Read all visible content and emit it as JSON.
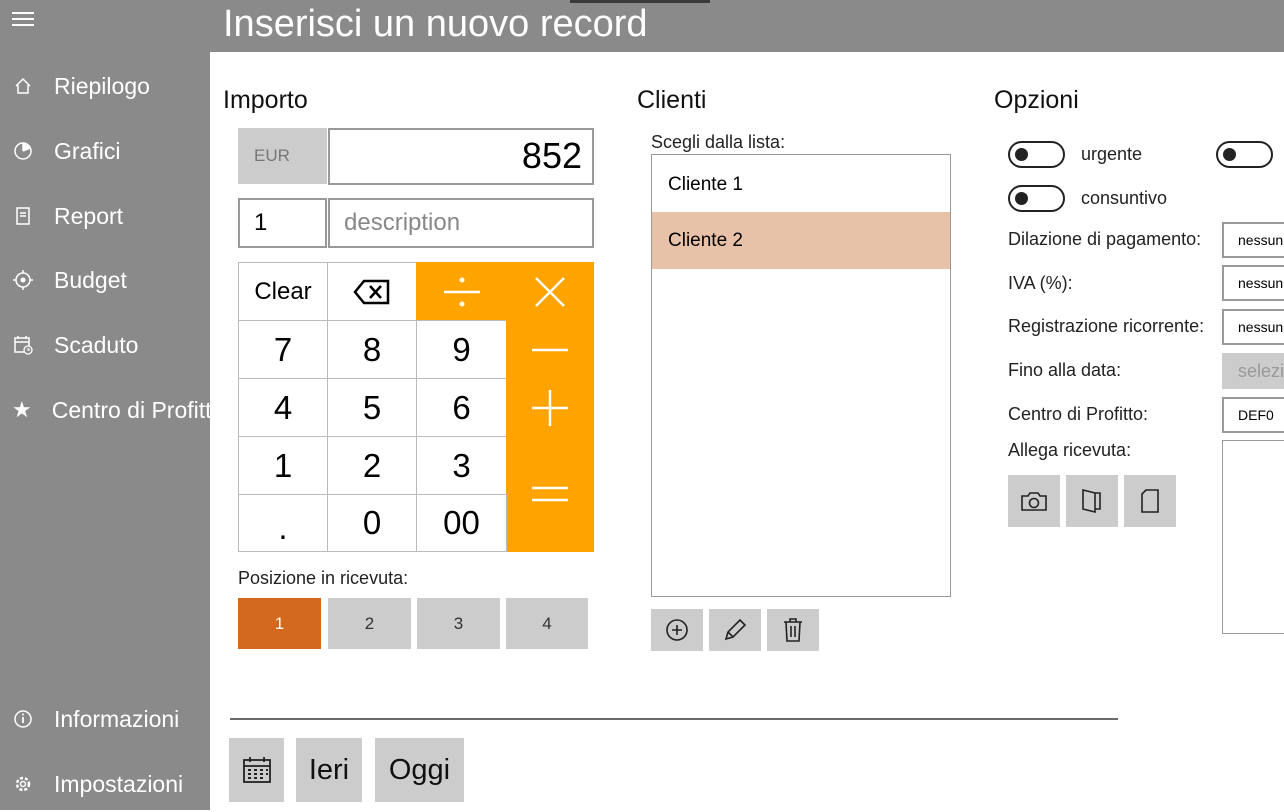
{
  "window": {
    "title": "Inserisci un nuovo record"
  },
  "sidebar": {
    "items": [
      {
        "label": "Riepilogo",
        "icon": "home-icon"
      },
      {
        "label": "Grafici",
        "icon": "pie-chart-icon"
      },
      {
        "label": "Report",
        "icon": "report-icon"
      },
      {
        "label": "Budget",
        "icon": "budget-icon"
      },
      {
        "label": "Scaduto",
        "icon": "calendar-due-icon"
      },
      {
        "label": "Centro di Profitto",
        "icon": "star-icon"
      }
    ],
    "bottom_items": [
      {
        "label": "Informazioni",
        "icon": "info-icon"
      },
      {
        "label": "Impostazioni",
        "icon": "gear-icon"
      }
    ]
  },
  "importo": {
    "title": "Importo",
    "currency": "EUR",
    "amount": "852",
    "quantity": "1",
    "description_placeholder": "description",
    "keys": {
      "clear": "Clear",
      "k7": "7",
      "k8": "8",
      "k9": "9",
      "k4": "4",
      "k5": "5",
      "k6": "6",
      "k1": "1",
      "k2": "2",
      "k3": "3",
      "dot": ".",
      "k0": "0",
      "k00": "00"
    },
    "position_label": "Posizione in ricevuta:",
    "positions": [
      "1",
      "2",
      "3",
      "4"
    ],
    "selected_position": "1"
  },
  "clienti": {
    "title": "Clienti",
    "subtitle": "Scegli dalla lista:",
    "items": [
      "Cliente 1",
      "Cliente 2"
    ],
    "selected": "Cliente 2"
  },
  "opzioni": {
    "title": "Opzioni",
    "toggles": [
      {
        "label": "urgente",
        "on": false
      },
      {
        "label": "consuntivo",
        "on": false
      }
    ],
    "fields": {
      "dilazione_label": "Dilazione di pagamento:",
      "dilazione_value": "nessun",
      "iva_label": "IVA (%):",
      "iva_value": "nessun",
      "ricorrente_label": "Registrazione ricorrente:",
      "ricorrente_value": "nessun",
      "fino_label": "Fino alla data:",
      "fino_value": "selezi",
      "centro_label": "Centro di Profitto:",
      "centro_value": "DEF0",
      "allega_label": "Allega ricevuta:"
    }
  },
  "date_buttons": {
    "ieri": "Ieri",
    "oggi": "Oggi"
  },
  "colors": {
    "sidebar": "#8a8a8a",
    "operator": "#ffa300",
    "selected_position": "#d2691e",
    "selected_client": "#e8c2a8",
    "button_gray": "#cccccc"
  }
}
